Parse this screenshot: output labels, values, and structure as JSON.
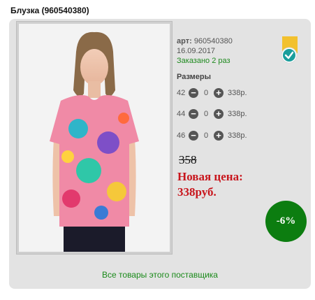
{
  "product": {
    "title": "Блузка (960540380)",
    "sku_label": "арт:",
    "sku": "960540380",
    "date": "16.09.2017",
    "ordered": "Заказано 2 раз"
  },
  "sizes": {
    "title": "Размеры",
    "rows": [
      {
        "size": "42",
        "qty": "0",
        "price": "338р.",
        "minus": "−",
        "plus": "+"
      },
      {
        "size": "44",
        "qty": "0",
        "price": "338р.",
        "minus": "−",
        "plus": "+"
      },
      {
        "size": "46",
        "qty": "0",
        "price": "338р.",
        "minus": "−",
        "plus": "+"
      }
    ]
  },
  "pricing": {
    "old_price": "358",
    "new_price_label": "Новая цена:",
    "new_price": "338руб.",
    "discount": "-6%"
  },
  "links": {
    "supplier": "Все товары этого поставщика"
  },
  "badge": {
    "icon": "verified-check-icon",
    "color": "#f2c12e",
    "check_color": "#1a9e9c"
  }
}
